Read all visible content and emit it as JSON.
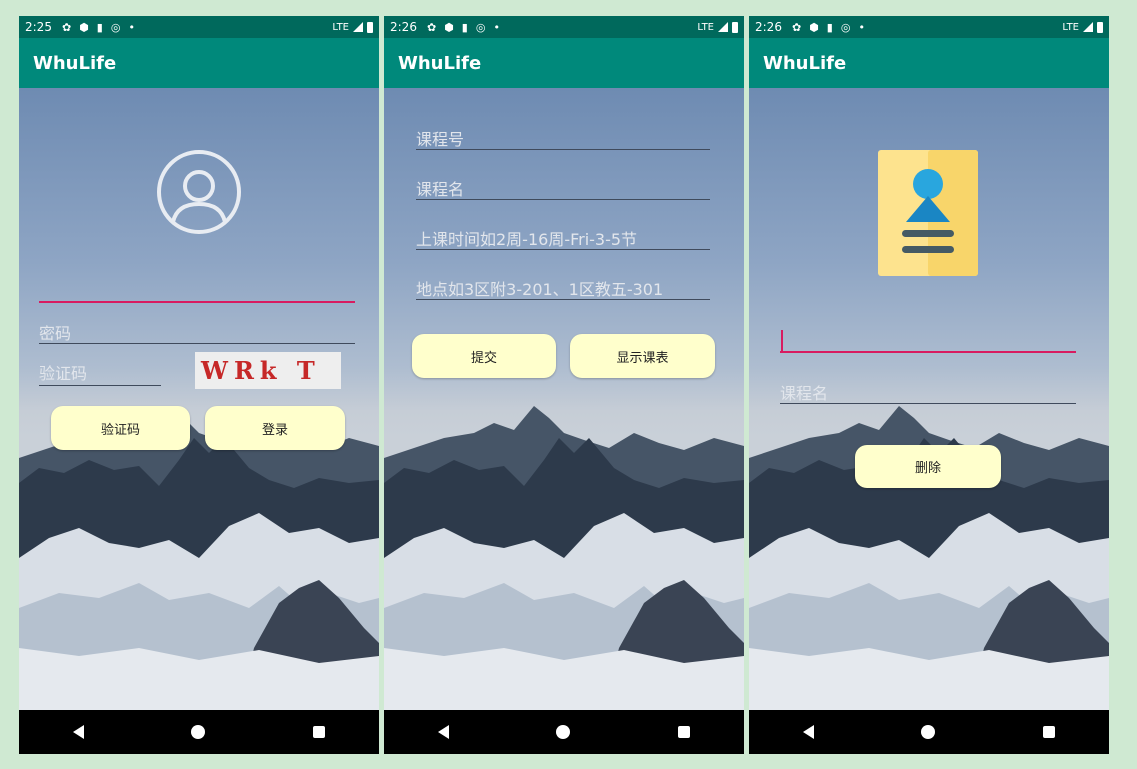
{
  "colors": {
    "status_bar": "#00695c",
    "app_bar": "#00897b",
    "button_bg": "#ffffcc",
    "accent_underline": "#d81b60",
    "page_bg": "#cfe9d2"
  },
  "screens": [
    {
      "status": {
        "time": "2:25",
        "network": "LTE"
      },
      "app_title": "WhuLife",
      "avatar_icon": "user-circle-icon",
      "username": {
        "value": ""
      },
      "password": {
        "placeholder": "密码"
      },
      "captcha_input": {
        "placeholder": "验证码"
      },
      "captcha_text": "WRk T",
      "buttons": {
        "captcha": "验证码",
        "login": "登录"
      }
    },
    {
      "status": {
        "time": "2:26",
        "network": "LTE"
      },
      "app_title": "WhuLife",
      "fields": {
        "course_no": "课程号",
        "course_name": "课程名",
        "time": "上课时间如2周-16周-Fri-3-5节",
        "location": "地点如3区附3-201、1区教五-301"
      },
      "buttons": {
        "submit": "提交",
        "show_schedule": "显示课表"
      }
    },
    {
      "status": {
        "time": "2:26",
        "network": "LTE"
      },
      "app_title": "WhuLife",
      "card_icon": "id-card-icon",
      "fields": {
        "input": "",
        "course_name": "课程名"
      },
      "buttons": {
        "delete": "删除"
      }
    }
  ]
}
